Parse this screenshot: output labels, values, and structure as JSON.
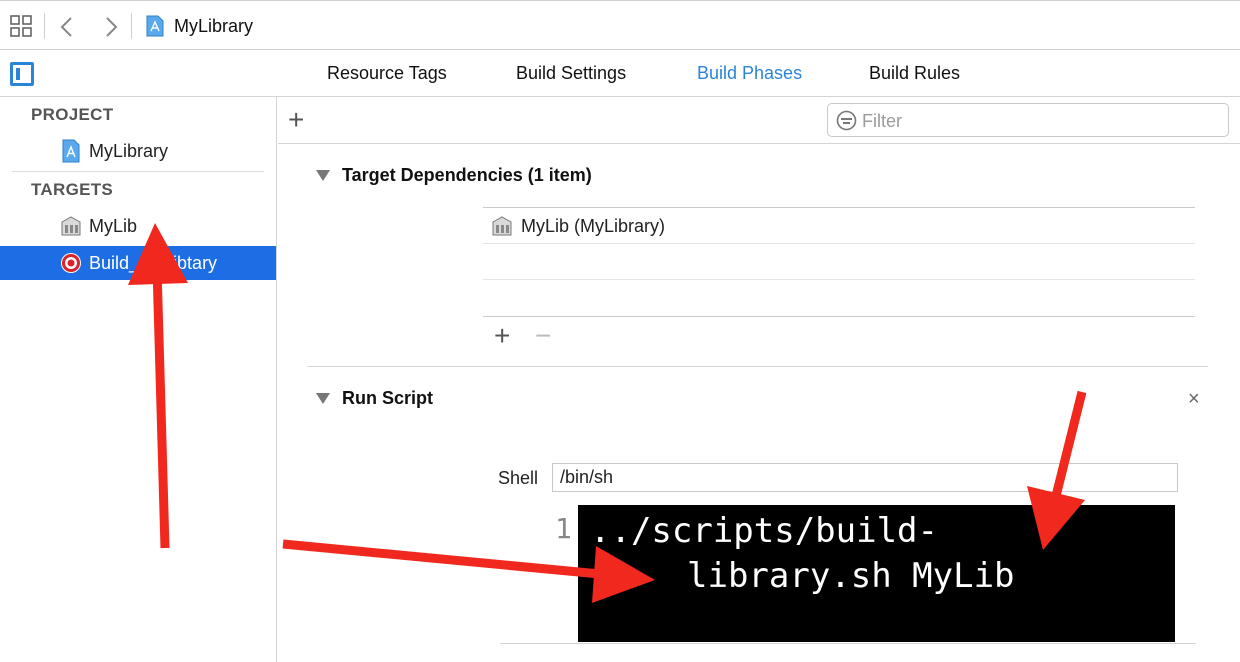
{
  "window": {
    "title": "MyLibrary"
  },
  "tabs": [
    {
      "label": "Resource Tags",
      "active": false
    },
    {
      "label": "Build Settings",
      "active": false
    },
    {
      "label": "Build Phases",
      "active": true
    },
    {
      "label": "Build Rules",
      "active": false
    }
  ],
  "sidebar": {
    "project_header": "PROJECT",
    "project_item": "MyLibrary",
    "targets_header": "TARGETS",
    "targets": [
      {
        "label": "MyLib",
        "selected": false,
        "icon": "building-icon"
      },
      {
        "label": "Build_MyLibtary",
        "selected": true,
        "icon": "target-icon"
      }
    ]
  },
  "toolbar": {
    "add_label": "+",
    "filter_placeholder": "Filter"
  },
  "dependencies": {
    "title": "Target Dependencies (1 item)",
    "items": [
      "MyLib (MyLibrary)"
    ],
    "add_label": "+",
    "remove_label": "−"
  },
  "run_script": {
    "title": "Run Script",
    "close_label": "×",
    "shell_label": "Shell",
    "shell_value": "/bin/sh",
    "line_number": "1",
    "script_line1": "../scripts/build-",
    "script_line2": "library.sh MyLib"
  },
  "colors": {
    "accent": "#2a85d9",
    "selection": "#1d6ee5",
    "annotation": "#f0281d"
  }
}
